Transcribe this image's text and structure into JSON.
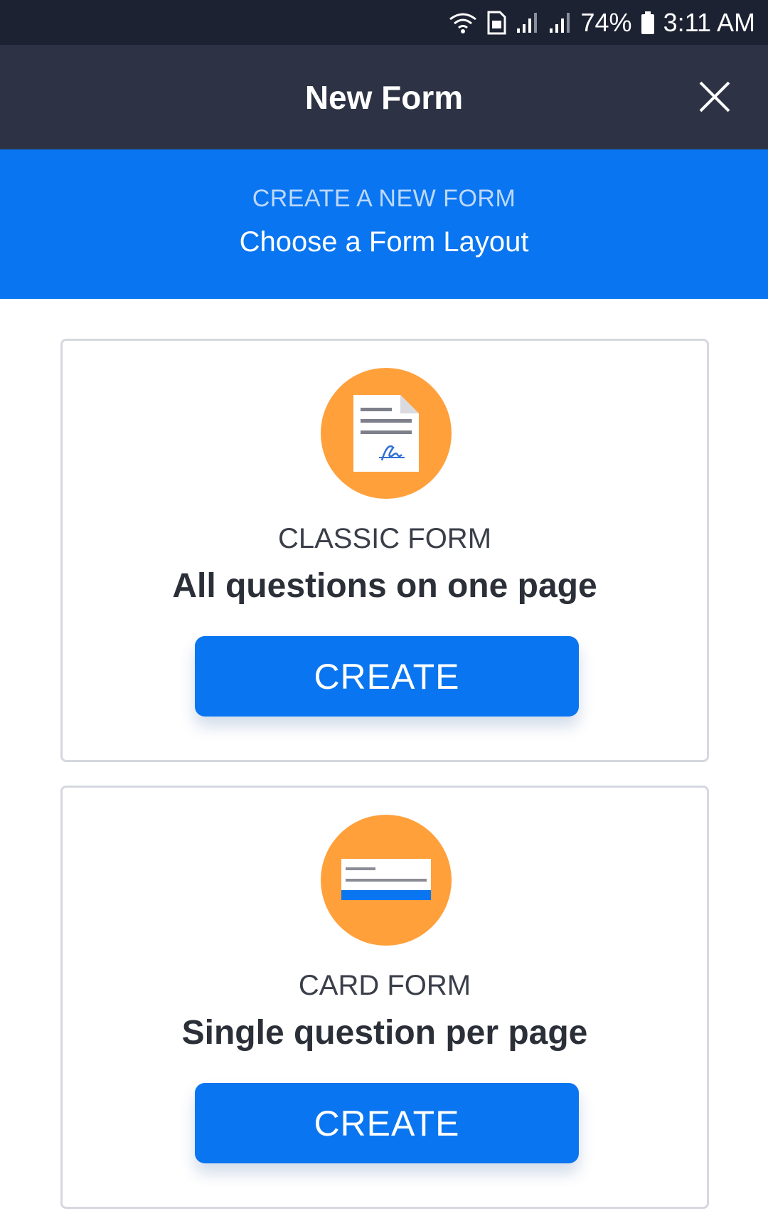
{
  "status_bar": {
    "battery": "74%",
    "time": "3:11 AM",
    "icons": [
      "wifi-icon",
      "sim-icon",
      "signal-icon",
      "signal-icon",
      "battery-icon"
    ]
  },
  "header": {
    "title": "New Form",
    "close_icon": "close-icon"
  },
  "banner": {
    "kicker": "CREATE A NEW FORM",
    "subtitle": "Choose a Form Layout"
  },
  "cards": [
    {
      "icon": "document-icon",
      "type": "CLASSIC FORM",
      "description": "All questions on one page",
      "button_label": "CREATE"
    },
    {
      "icon": "card-icon",
      "type": "CARD FORM",
      "description": "Single question per page",
      "button_label": "CREATE"
    }
  ],
  "colors": {
    "status_bar": "#1d2232",
    "title_bar": "#2d3344",
    "accent_blue": "#0a75f0",
    "icon_orange": "#ffa03b"
  }
}
